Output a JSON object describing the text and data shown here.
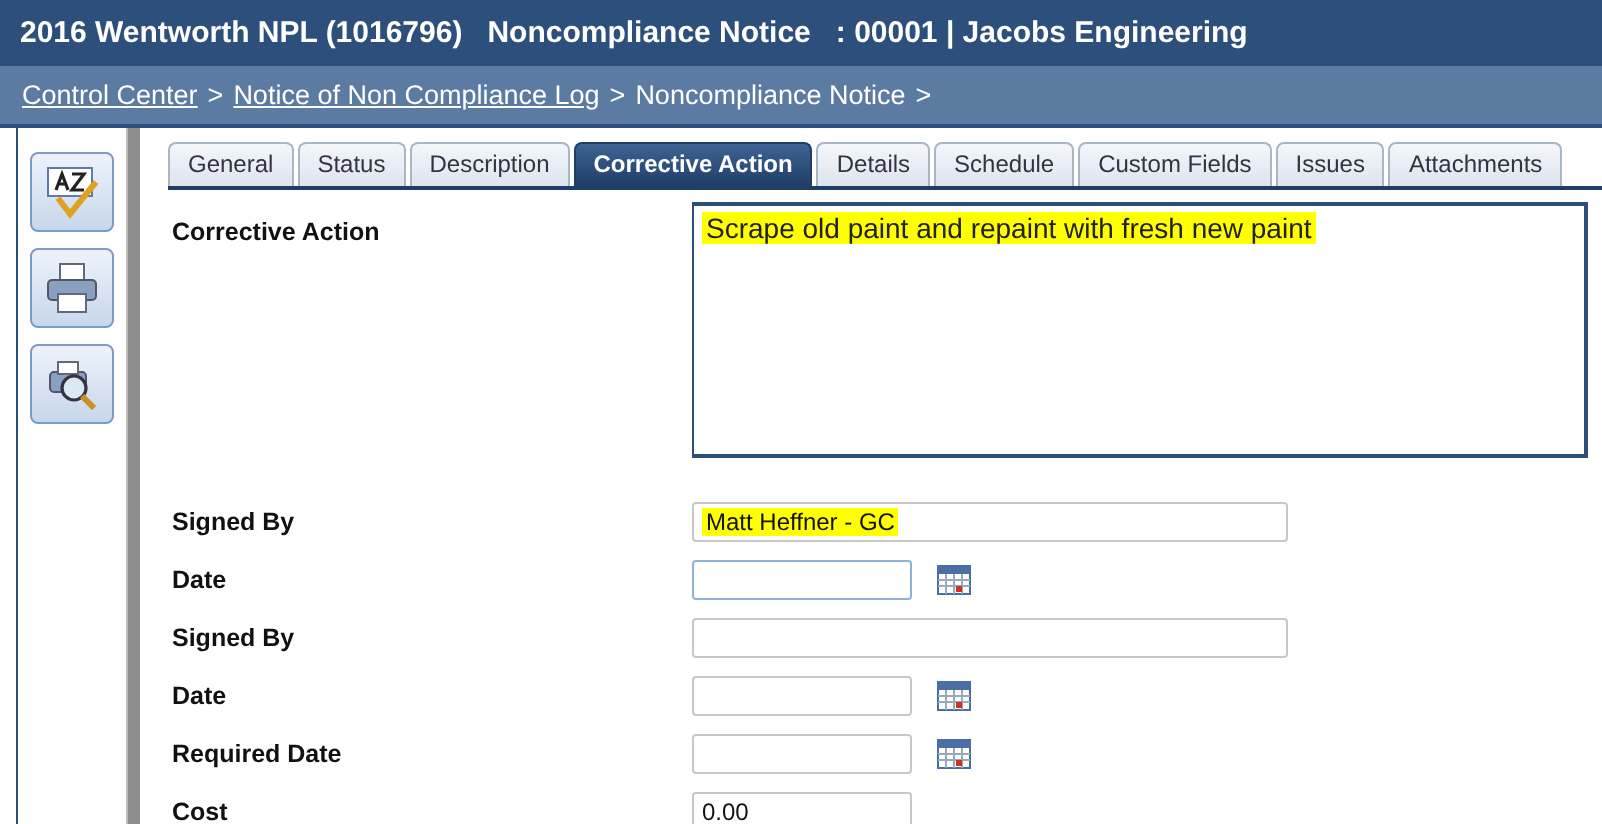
{
  "window": {
    "title": "2016 Wentworth NPL (1016796)   Noncompliance Notice   : 00001 | Jacobs Engineering"
  },
  "breadcrumb": [
    {
      "label": "Control Center",
      "kind": "link",
      "separator": ">"
    },
    {
      "label": "Notice of Non Compliance Log",
      "kind": "link",
      "separator": ">"
    },
    {
      "label": "Noncompliance Notice",
      "kind": "current",
      "separator": ">"
    }
  ],
  "toolbar": [
    {
      "kind": "spellcheck"
    },
    {
      "kind": "print"
    },
    {
      "kind": "preview"
    }
  ],
  "tabs": [
    {
      "label": "General",
      "selected": false
    },
    {
      "label": "Status",
      "selected": false
    },
    {
      "label": "Description",
      "selected": false
    },
    {
      "label": "Corrective Action",
      "selected": true
    },
    {
      "label": "Details",
      "selected": false
    },
    {
      "label": "Schedule",
      "selected": false
    },
    {
      "label": "Custom Fields",
      "selected": false
    },
    {
      "label": "Issues",
      "selected": false
    },
    {
      "label": "Attachments",
      "selected": false
    }
  ],
  "fields": [
    {
      "label": "Corrective Action",
      "kind": "textarea",
      "value": "Scrape old paint and repaint with fresh new paint",
      "highlighted": true
    },
    {
      "label": "Signed By",
      "kind": "text",
      "value": "Matt Heffner - GC",
      "highlighted": true
    },
    {
      "label": "Date",
      "kind": "date",
      "focused": true
    },
    {
      "label": "Signed By",
      "kind": "text"
    },
    {
      "label": "Date",
      "kind": "date"
    },
    {
      "label": "Required Date",
      "kind": "date"
    },
    {
      "label": "Cost",
      "kind": "short",
      "value": "0.00"
    }
  ]
}
